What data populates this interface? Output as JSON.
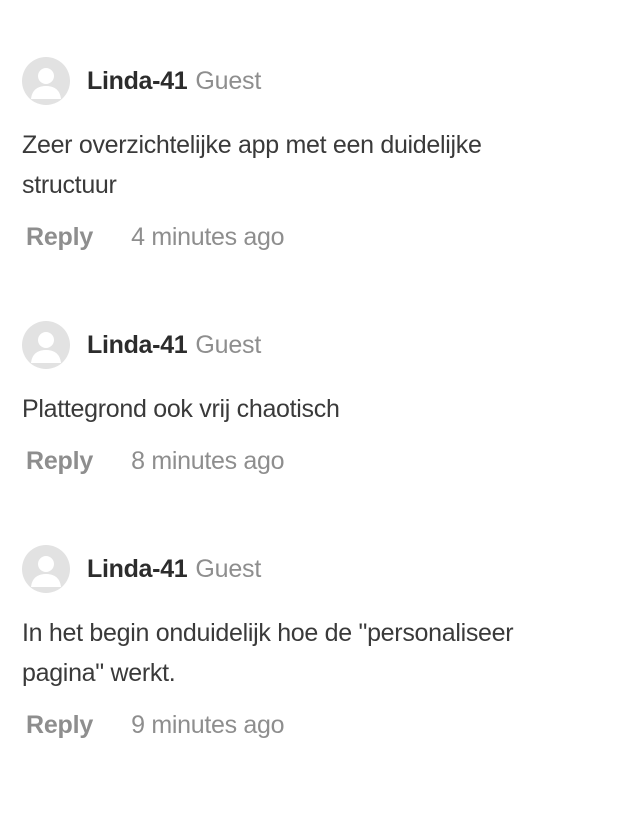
{
  "comments": [
    {
      "author": "Linda-41",
      "role": "Guest",
      "text": "Zeer overzichtelijke app met een duidelijke structuur",
      "reply_label": "Reply",
      "timestamp": "4 minutes ago",
      "avatar_icon": "default-user-icon"
    },
    {
      "author": "Linda-41",
      "role": "Guest",
      "text": "Plattegrond ook vrij chaotisch",
      "reply_label": "Reply",
      "timestamp": "8 minutes ago",
      "avatar_icon": "default-user-icon"
    },
    {
      "author": "Linda-41",
      "role": "Guest",
      "text": "In het begin onduidelijk hoe de \"personaliseer pagina\" werkt.",
      "reply_label": "Reply",
      "timestamp": "9 minutes ago",
      "avatar_icon": "default-user-icon"
    }
  ],
  "colors": {
    "author": "#2c2c2c",
    "body": "#3a3a3a",
    "muted": "#8e8e8e",
    "avatar_bg": "#e2e2e2",
    "avatar_fg": "#ffffff"
  }
}
